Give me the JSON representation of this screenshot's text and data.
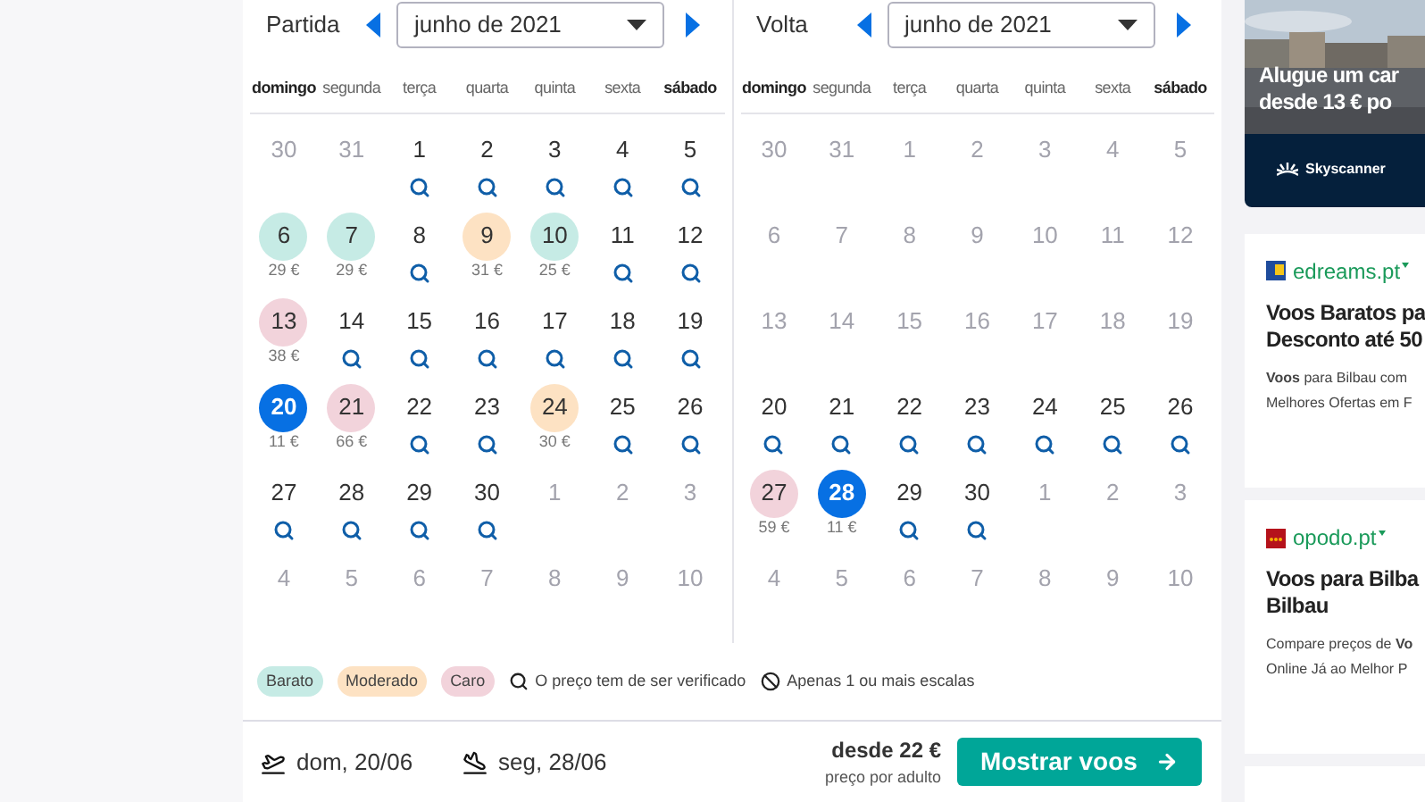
{
  "calendars": [
    {
      "label": "Partida",
      "month": "junho de 2021",
      "weekdays": [
        {
          "name": "domingo",
          "weekend": true
        },
        {
          "name": "segunda",
          "weekend": false
        },
        {
          "name": "terça",
          "weekend": false
        },
        {
          "name": "quarta",
          "weekend": false
        },
        {
          "name": "quinta",
          "weekend": false
        },
        {
          "name": "sexta",
          "weekend": false
        },
        {
          "name": "sábado",
          "weekend": true
        }
      ],
      "weeks": [
        [
          {
            "day": "30",
            "kind": "muted",
            "selected": false
          },
          {
            "day": "31",
            "kind": "muted",
            "selected": false
          },
          {
            "day": "1",
            "kind": "search",
            "selected": false
          },
          {
            "day": "2",
            "kind": "search",
            "selected": false
          },
          {
            "day": "3",
            "kind": "search",
            "selected": false
          },
          {
            "day": "4",
            "kind": "search",
            "selected": false
          },
          {
            "day": "5",
            "kind": "search",
            "selected": false
          }
        ],
        [
          {
            "day": "6",
            "kind": "price",
            "color": "#c6ebe5",
            "price": "29 €",
            "selected": false
          },
          {
            "day": "7",
            "kind": "price",
            "color": "#c6ebe5",
            "price": "29 €",
            "selected": false
          },
          {
            "day": "8",
            "kind": "search",
            "selected": false
          },
          {
            "day": "9",
            "kind": "price",
            "color": "#fde2c3",
            "price": "31 €",
            "selected": false
          },
          {
            "day": "10",
            "kind": "price",
            "color": "#c6ebe5",
            "price": "25 €",
            "selected": false
          },
          {
            "day": "11",
            "kind": "search",
            "selected": false
          },
          {
            "day": "12",
            "kind": "search",
            "selected": false
          }
        ],
        [
          {
            "day": "13",
            "kind": "price",
            "color": "#f2d3db",
            "price": "38 €",
            "selected": false
          },
          {
            "day": "14",
            "kind": "search",
            "selected": false
          },
          {
            "day": "15",
            "kind": "search",
            "selected": false
          },
          {
            "day": "16",
            "kind": "search",
            "selected": false
          },
          {
            "day": "17",
            "kind": "search",
            "selected": false
          },
          {
            "day": "18",
            "kind": "search",
            "selected": false
          },
          {
            "day": "19",
            "kind": "search",
            "selected": false
          }
        ],
        [
          {
            "day": "20",
            "kind": "price",
            "price": "11 €",
            "selected": true
          },
          {
            "day": "21",
            "kind": "price",
            "color": "#f2d3db",
            "price": "66 €",
            "selected": false
          },
          {
            "day": "22",
            "kind": "search",
            "selected": false
          },
          {
            "day": "23",
            "kind": "search",
            "selected": false
          },
          {
            "day": "24",
            "kind": "price",
            "color": "#fde2c3",
            "price": "30 €",
            "selected": false
          },
          {
            "day": "25",
            "kind": "search",
            "selected": false
          },
          {
            "day": "26",
            "kind": "search",
            "selected": false
          }
        ],
        [
          {
            "day": "27",
            "kind": "search",
            "selected": false
          },
          {
            "day": "28",
            "kind": "search",
            "selected": false
          },
          {
            "day": "29",
            "kind": "search",
            "selected": false
          },
          {
            "day": "30",
            "kind": "search",
            "selected": false
          },
          {
            "day": "1",
            "kind": "muted",
            "selected": false
          },
          {
            "day": "2",
            "kind": "muted",
            "selected": false
          },
          {
            "day": "3",
            "kind": "muted",
            "selected": false
          }
        ],
        [
          {
            "day": "4",
            "kind": "muted",
            "selected": false
          },
          {
            "day": "5",
            "kind": "muted",
            "selected": false
          },
          {
            "day": "6",
            "kind": "muted",
            "selected": false
          },
          {
            "day": "7",
            "kind": "muted",
            "selected": false
          },
          {
            "day": "8",
            "kind": "muted",
            "selected": false
          },
          {
            "day": "9",
            "kind": "muted",
            "selected": false
          },
          {
            "day": "10",
            "kind": "muted",
            "selected": false
          }
        ]
      ]
    },
    {
      "label": "Volta",
      "month": "junho de 2021",
      "weekdays": [
        {
          "name": "domingo",
          "weekend": true
        },
        {
          "name": "segunda",
          "weekend": false
        },
        {
          "name": "terça",
          "weekend": false
        },
        {
          "name": "quarta",
          "weekend": false
        },
        {
          "name": "quinta",
          "weekend": false
        },
        {
          "name": "sexta",
          "weekend": false
        },
        {
          "name": "sábado",
          "weekend": true
        }
      ],
      "weeks": [
        [
          {
            "day": "30",
            "kind": "muted",
            "selected": false
          },
          {
            "day": "31",
            "kind": "muted",
            "selected": false
          },
          {
            "day": "1",
            "kind": "muted",
            "selected": false
          },
          {
            "day": "2",
            "kind": "muted",
            "selected": false
          },
          {
            "day": "3",
            "kind": "muted",
            "selected": false
          },
          {
            "day": "4",
            "kind": "muted",
            "selected": false
          },
          {
            "day": "5",
            "kind": "muted",
            "selected": false
          }
        ],
        [
          {
            "day": "6",
            "kind": "muted",
            "selected": false
          },
          {
            "day": "7",
            "kind": "muted",
            "selected": false
          },
          {
            "day": "8",
            "kind": "muted",
            "selected": false
          },
          {
            "day": "9",
            "kind": "muted",
            "selected": false
          },
          {
            "day": "10",
            "kind": "muted",
            "selected": false
          },
          {
            "day": "11",
            "kind": "muted",
            "selected": false
          },
          {
            "day": "12",
            "kind": "muted",
            "selected": false
          }
        ],
        [
          {
            "day": "13",
            "kind": "muted",
            "selected": false
          },
          {
            "day": "14",
            "kind": "muted",
            "selected": false
          },
          {
            "day": "15",
            "kind": "muted",
            "selected": false
          },
          {
            "day": "16",
            "kind": "muted",
            "selected": false
          },
          {
            "day": "17",
            "kind": "muted",
            "selected": false
          },
          {
            "day": "18",
            "kind": "muted",
            "selected": false
          },
          {
            "day": "19",
            "kind": "muted",
            "selected": false
          }
        ],
        [
          {
            "day": "20",
            "kind": "search",
            "selected": false
          },
          {
            "day": "21",
            "kind": "search",
            "selected": false
          },
          {
            "day": "22",
            "kind": "search",
            "selected": false
          },
          {
            "day": "23",
            "kind": "search",
            "selected": false
          },
          {
            "day": "24",
            "kind": "search",
            "selected": false
          },
          {
            "day": "25",
            "kind": "search",
            "selected": false
          },
          {
            "day": "26",
            "kind": "search",
            "selected": false
          }
        ],
        [
          {
            "day": "27",
            "kind": "price",
            "color": "#f2d3db",
            "price": "59 €",
            "selected": false
          },
          {
            "day": "28",
            "kind": "price",
            "price": "11 €",
            "selected": true
          },
          {
            "day": "29",
            "kind": "search",
            "selected": false
          },
          {
            "day": "30",
            "kind": "search",
            "selected": false
          },
          {
            "day": "1",
            "kind": "muted",
            "selected": false
          },
          {
            "day": "2",
            "kind": "muted",
            "selected": false
          },
          {
            "day": "3",
            "kind": "muted",
            "selected": false
          }
        ],
        [
          {
            "day": "4",
            "kind": "muted",
            "selected": false
          },
          {
            "day": "5",
            "kind": "muted",
            "selected": false
          },
          {
            "day": "6",
            "kind": "muted",
            "selected": false
          },
          {
            "day": "7",
            "kind": "muted",
            "selected": false
          },
          {
            "day": "8",
            "kind": "muted",
            "selected": false
          },
          {
            "day": "9",
            "kind": "muted",
            "selected": false
          },
          {
            "day": "10",
            "kind": "muted",
            "selected": false
          }
        ]
      ]
    }
  ],
  "legend": [
    {
      "kind": "chip",
      "color": "#c6ebe5",
      "label": "Barato"
    },
    {
      "kind": "chip",
      "color": "#fde2c3",
      "label": "Moderado"
    },
    {
      "kind": "chip",
      "color": "#f2d3db",
      "label": "Caro"
    },
    {
      "kind": "search",
      "label": "O preço tem de ser verificado"
    },
    {
      "kind": "stops",
      "label": "Apenas 1 ou mais escalas"
    }
  ],
  "footer": {
    "legs": [
      {
        "kind": "outbound",
        "date": "dom, 20/06"
      },
      {
        "kind": "return",
        "date": "seg, 28/06"
      }
    ],
    "price": "desde 22 €",
    "price_note": "preço por adulto",
    "button": "Mostrar voos"
  },
  "ads": {
    "banner": {
      "lines": [
        "Alugue um car",
        "desde 13 € po"
      ],
      "brand": "Skyscanner"
    },
    "cards": [
      {
        "domain": "edreams.pt",
        "kind": "edreams",
        "title": [
          "Voos Baratos pa",
          "Desconto até 50"
        ],
        "body": [
          "**Voos** para Bilbau com",
          "Melhores Ofertas em F"
        ]
      },
      {
        "domain": "opodo.pt",
        "kind": "opodo",
        "title": [
          "Voos para Bilba",
          "Bilbau"
        ],
        "body": [
          "Compare preços de **Vo**",
          "Online Já ao Melhor P"
        ]
      }
    ]
  }
}
